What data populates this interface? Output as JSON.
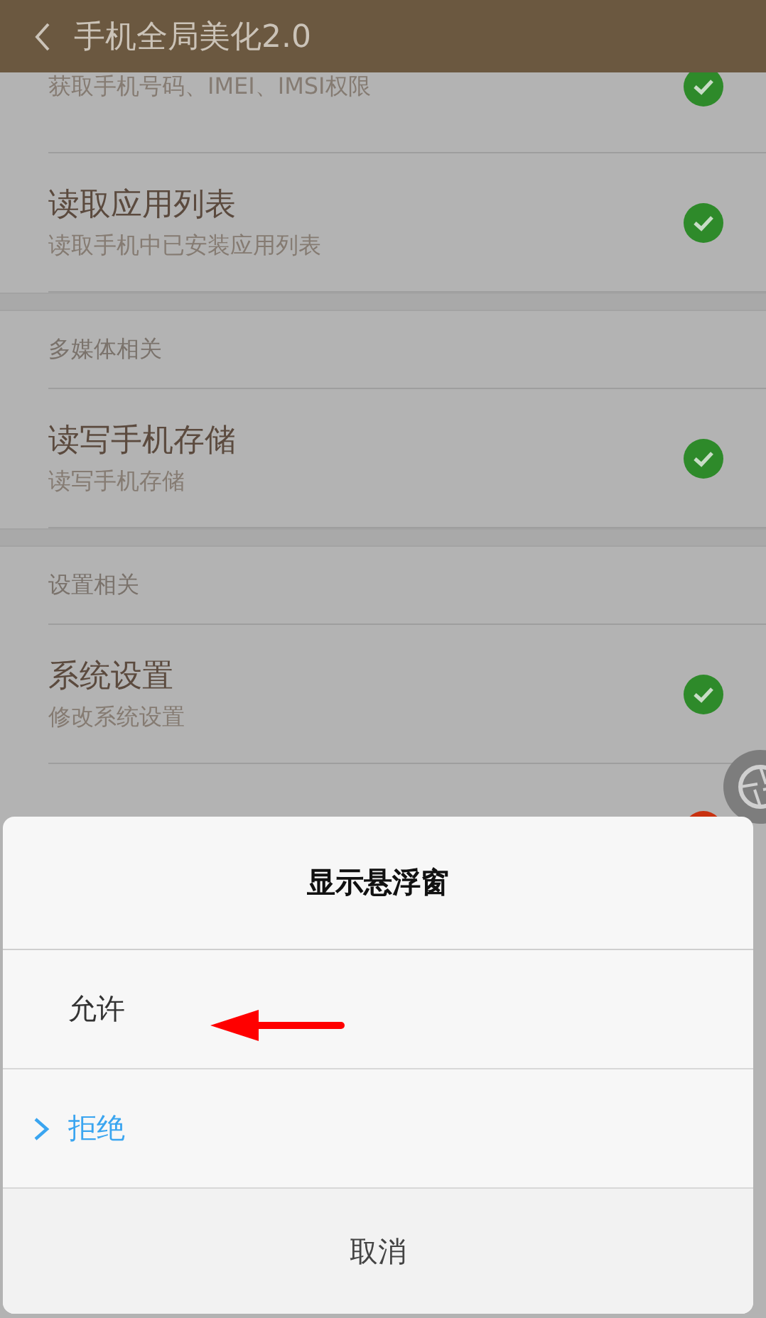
{
  "header": {
    "title": "手机全局美化2.0"
  },
  "sections": [
    {
      "items": [
        {
          "subtitle": "获取手机号码、IMEI、IMSI权限",
          "granted": true
        },
        {
          "title": "读取应用列表",
          "subtitle": "读取手机中已安装应用列表",
          "granted": true
        }
      ]
    },
    {
      "heading": "多媒体相关",
      "items": [
        {
          "title": "读写手机存储",
          "subtitle": "读写手机存储",
          "granted": true
        }
      ]
    },
    {
      "heading": "设置相关",
      "items": [
        {
          "title": "系统设置",
          "subtitle": "修改系统设置",
          "granted": true
        },
        {
          "granted": false
        }
      ]
    }
  ],
  "dialog": {
    "title": "显示悬浮窗",
    "options": [
      {
        "label": "允许",
        "selected": false
      },
      {
        "label": "拒绝",
        "selected": true
      }
    ],
    "cancel": "取消"
  }
}
